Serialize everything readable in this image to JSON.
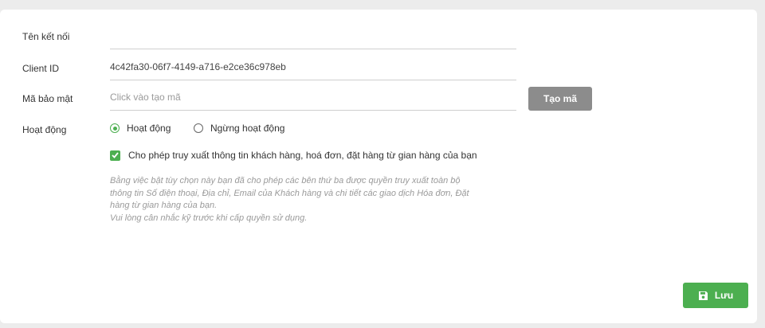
{
  "form": {
    "connection_name": {
      "label": "Tên kết nối",
      "value": "",
      "placeholder": ""
    },
    "client_id": {
      "label": "Client ID",
      "value": "4c42fa30-06f7-4149-a716-e2ce36c978eb"
    },
    "secret": {
      "label": "Mã bảo mật",
      "value": "",
      "placeholder": "Click vào tạo mã",
      "generate_label": "Tạo mã"
    },
    "status": {
      "label": "Hoạt động",
      "options": [
        {
          "label": "Hoạt động",
          "checked": true
        },
        {
          "label": "Ngừng hoạt động",
          "checked": false
        }
      ]
    },
    "permission": {
      "label": "Cho phép truy xuất thông tin khách hàng, hoá đơn, đặt hàng từ gian hàng của bạn",
      "checked": true
    },
    "note_lines": [
      "Bằng việc bật tùy chọn này bạn đã cho phép các bên thứ ba được quyền truy xuất toàn bộ",
      "thông tin Số điện thoại, Địa chỉ, Email của Khách hàng và chi tiết các giao dịch Hóa đơn, Đặt",
      "hàng từ gian hàng của bạn.",
      "Vui lòng cân nhắc kỹ trước khi cấp quyền sử dụng."
    ]
  },
  "actions": {
    "save_label": "Lưu",
    "save_icon": "floppy-disk-icon"
  },
  "colors": {
    "accent": "#4caf50",
    "secondary_button": "#8c8c8c"
  }
}
